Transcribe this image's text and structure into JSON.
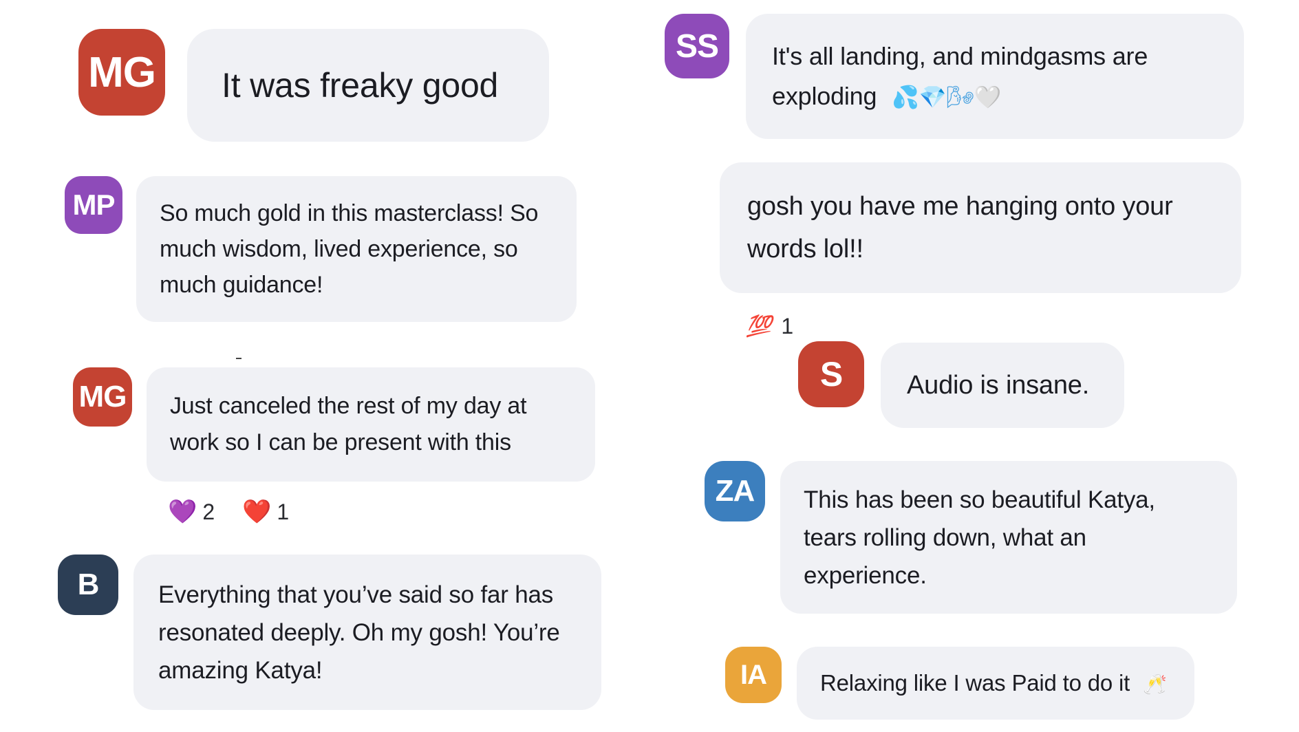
{
  "colors": {
    "bubble_bg": "#f0f1f5",
    "avatar_mg": "#c44332",
    "avatar_mp": "#8e4bb9",
    "avatar_b": "#2c3e55",
    "avatar_ss": "#8e4bb9",
    "avatar_s": "#c44332",
    "avatar_za": "#3c7fbe",
    "avatar_ia": "#eaa53a"
  },
  "messages": [
    {
      "id": "m1",
      "avatar_initials": "MG",
      "text": "It was freaky good"
    },
    {
      "id": "m2",
      "avatar_initials": "MP",
      "text": "So much gold in this masterclass! So much wisdom, lived experience, so much guidance!"
    },
    {
      "id": "m3",
      "avatar_initials": "MG",
      "text": "Just canceled the rest of my day at work so I can be present with this",
      "reactions": [
        {
          "emoji": "💜",
          "count": "2"
        },
        {
          "emoji": "❤️",
          "count": "1"
        }
      ]
    },
    {
      "id": "m4",
      "avatar_initials": "B",
      "text": "Everything that you’ve said so far has resonated deeply. Oh my gosh! You’re amazing Katya!"
    },
    {
      "id": "m5",
      "avatar_initials": "SS",
      "text": "It's all landing, and mindgasms are exploding",
      "emojis": "💦💎🌬🤍"
    },
    {
      "id": "m6",
      "text": "gosh you have me hanging onto your words lol!!",
      "reactions": [
        {
          "emoji": "💯",
          "count": "1"
        }
      ]
    },
    {
      "id": "m7",
      "avatar_initials": "S",
      "text": "Audio is insane."
    },
    {
      "id": "m8",
      "avatar_initials": "ZA",
      "text": "This has been so beautiful Katya, tears rolling down, what an experience."
    },
    {
      "id": "m9",
      "avatar_initials": "IA",
      "text": "Relaxing like I was Paid to do it",
      "emojis": "🥂"
    }
  ]
}
